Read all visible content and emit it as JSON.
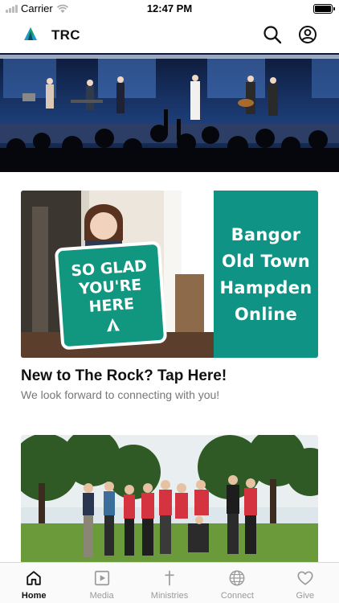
{
  "status_bar": {
    "carrier": "Carrier",
    "time": "12:47 PM"
  },
  "header": {
    "title": "TRC"
  },
  "cards": [
    {
      "title": "New to The Rock? Tap Here!",
      "subtitle": "We look forward to connecting with you!",
      "sign_text": [
        "SO GLAD",
        "YOU'RE",
        "HERE"
      ],
      "locations": [
        "Bangor",
        "Old Town",
        "Hampden",
        "Online"
      ]
    },
    {
      "title": "",
      "subtitle": ""
    }
  ],
  "tabs": [
    {
      "label": "Home",
      "icon": "home-icon",
      "active": true
    },
    {
      "label": "Media",
      "icon": "media-icon",
      "active": false
    },
    {
      "label": "Ministries",
      "icon": "cross-icon",
      "active": false
    },
    {
      "label": "Connect",
      "icon": "globe-icon",
      "active": false
    },
    {
      "label": "Give",
      "icon": "heart-icon",
      "active": false
    }
  ],
  "colors": {
    "brand_teal": "#0e9384",
    "tab_active": "#111111",
    "tab_inactive": "#9a9a9a"
  }
}
